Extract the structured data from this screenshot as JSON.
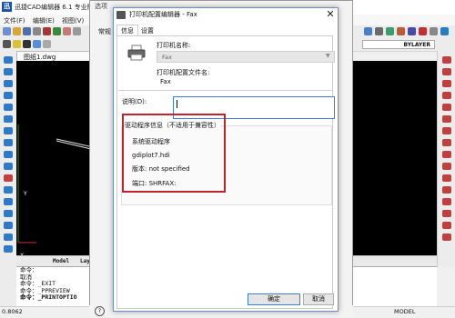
{
  "app": {
    "title": "迅捷CAD编辑器 6.1 专业版",
    "logo": "迅",
    "menu": [
      "文件(F)",
      "编辑(E)",
      "视图(V)"
    ],
    "document_tab": "图纸1.dwg",
    "layer_box": "BYLAYER",
    "layout_tabs": [
      "Model",
      "Lay"
    ],
    "command_history": [
      "命令：",
      "取消",
      "命令：_EXIT",
      "命令：_PPREVIEW",
      "命令：_PRINTOPTIO"
    ],
    "status_left": "0.8062",
    "status_right": "MODEL"
  },
  "options_dialog": {
    "title": "选项",
    "tab_label": "常规",
    "help_glyph": "?"
  },
  "dialog": {
    "title": "打印机配置编辑器 - Fax",
    "close_glyph": "✕",
    "tabs": {
      "info": "信息",
      "settings": "设置"
    },
    "printer_name_label": "打印机名称:",
    "printer_name_value": "Fax",
    "config_file_label": "打印机配置文件名:",
    "config_file_value": "Fax",
    "description_label": "说明(D):",
    "description_value": "",
    "driver_info": {
      "heading": "驱动程序信息（不适用于兼容性）",
      "system_driver": "系统驱动程序",
      "file": "gdiplot7.hdi",
      "version": "版本: not specified",
      "port": "端口: SHRFAX:"
    },
    "ok_label": "确定",
    "cancel_label": "取消"
  },
  "colors": {
    "highlight": "#c0232c",
    "focus_border": "#3c7fd1",
    "canvas": "#000000"
  }
}
